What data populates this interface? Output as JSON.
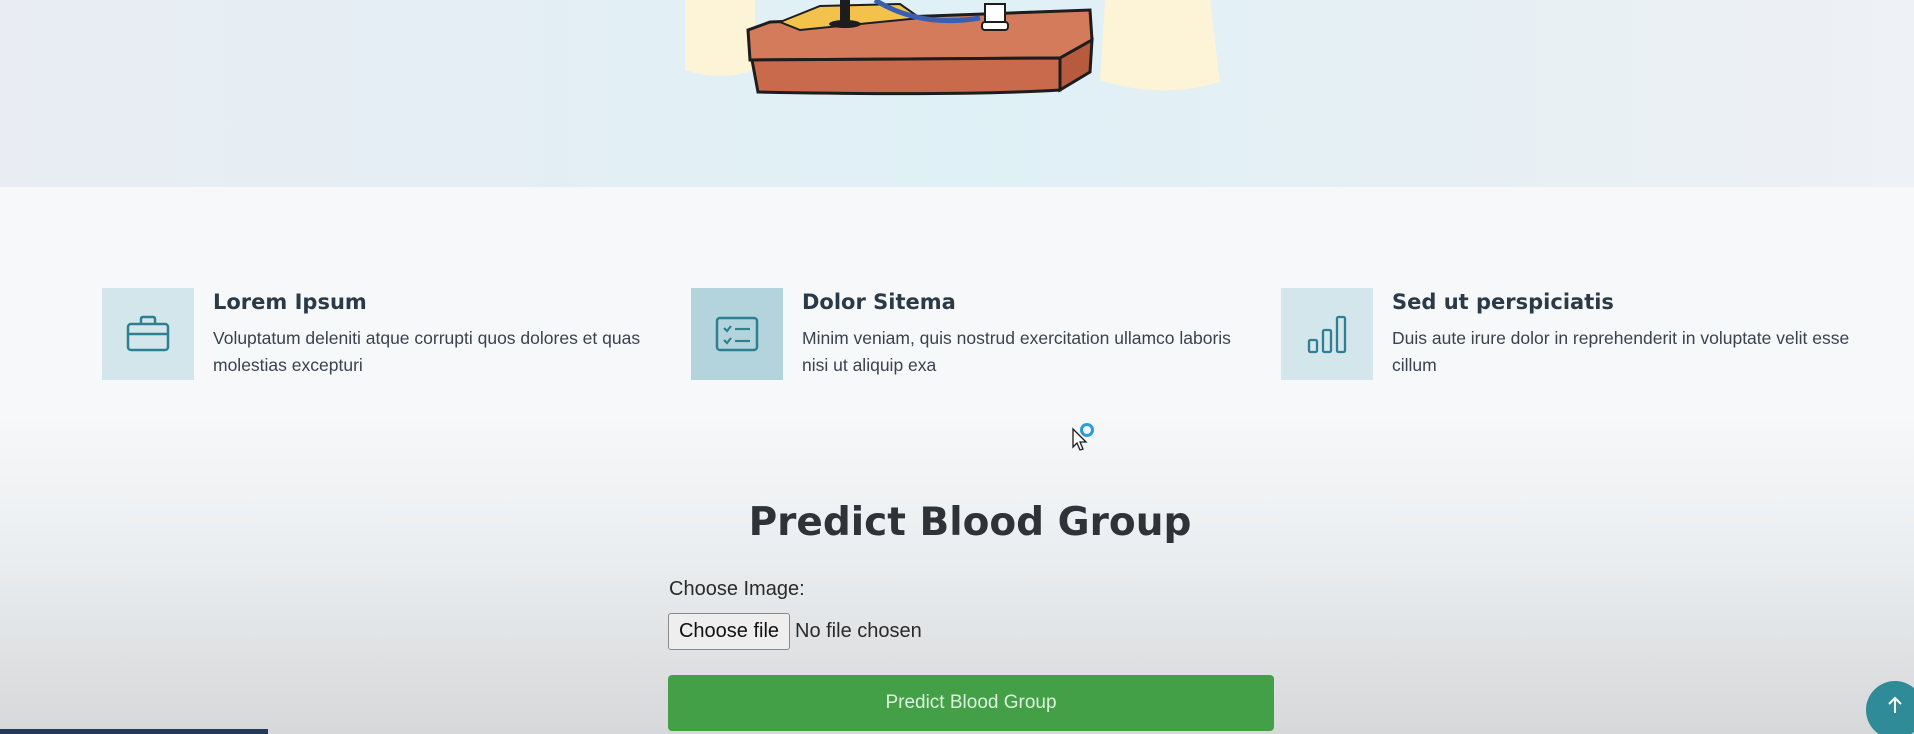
{
  "features": [
    {
      "icon": "briefcase-icon",
      "title": "Lorem Ipsum",
      "description": "Voluptatum deleniti atque corrupti quos dolores et quas molestias excepturi"
    },
    {
      "icon": "checklist-icon",
      "title": "Dolor Sitema",
      "description": "Minim veniam, quis nostrud exercitation ullamco laboris nisi ut aliquip exa"
    },
    {
      "icon": "bar-chart-icon",
      "title": "Sed ut perspiciatis",
      "description": "Duis aute irure dolor in reprehenderit in voluptate velit esse cillum"
    }
  ],
  "form": {
    "title": "Predict Blood Group",
    "choose_label": "Choose Image:",
    "file_button": "Choose file",
    "file_status": "No file chosen",
    "submit_label": "Predict Blood Group"
  },
  "colors": {
    "accent_teal": "#2e8b97",
    "icon_box": "#d3e6ec",
    "submit_green": "#43a047"
  }
}
